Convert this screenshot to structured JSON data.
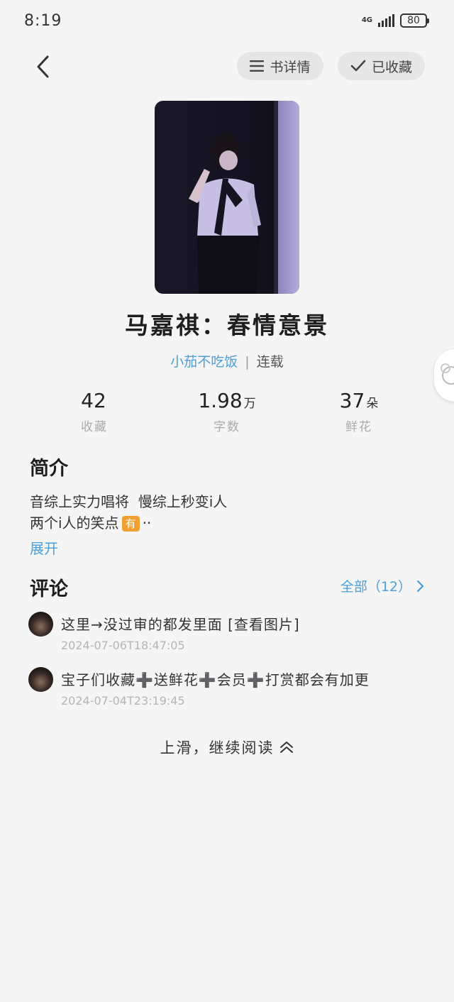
{
  "status_bar": {
    "time": "8:19",
    "network": "4G",
    "battery": "80"
  },
  "header": {
    "detail_label": "书详情",
    "favorited_label": "已收藏"
  },
  "book": {
    "title": "马嘉祺：春情意景",
    "author": "小茄不吃饭",
    "separator": "|",
    "status": "连载"
  },
  "stats": [
    {
      "value": "42",
      "unit": "",
      "label": "收藏"
    },
    {
      "value": "1.98",
      "unit": "万",
      "label": "字数"
    },
    {
      "value": "37",
      "unit": "朵",
      "label": "鲜花"
    }
  ],
  "intro": {
    "title": "简介",
    "line1": "音综上实力唱将  慢综上秒变i人",
    "line2_text": "两个i人的笑点",
    "line2_badge": "有",
    "line2_tail": "··",
    "expand_label": "展开"
  },
  "comments": {
    "title": "评论",
    "all_label": "全部（12）",
    "items": [
      {
        "text": "这里→没过审的都发里面 [查看图片]",
        "time": "2024-07-06T18:47:05"
      },
      {
        "text": "宝子们收藏➕送鲜花➕会员➕打赏都会有加更",
        "time": "2024-07-04T23:19:45"
      }
    ]
  },
  "footer": {
    "read_more_label": "上滑，继续阅读"
  }
}
